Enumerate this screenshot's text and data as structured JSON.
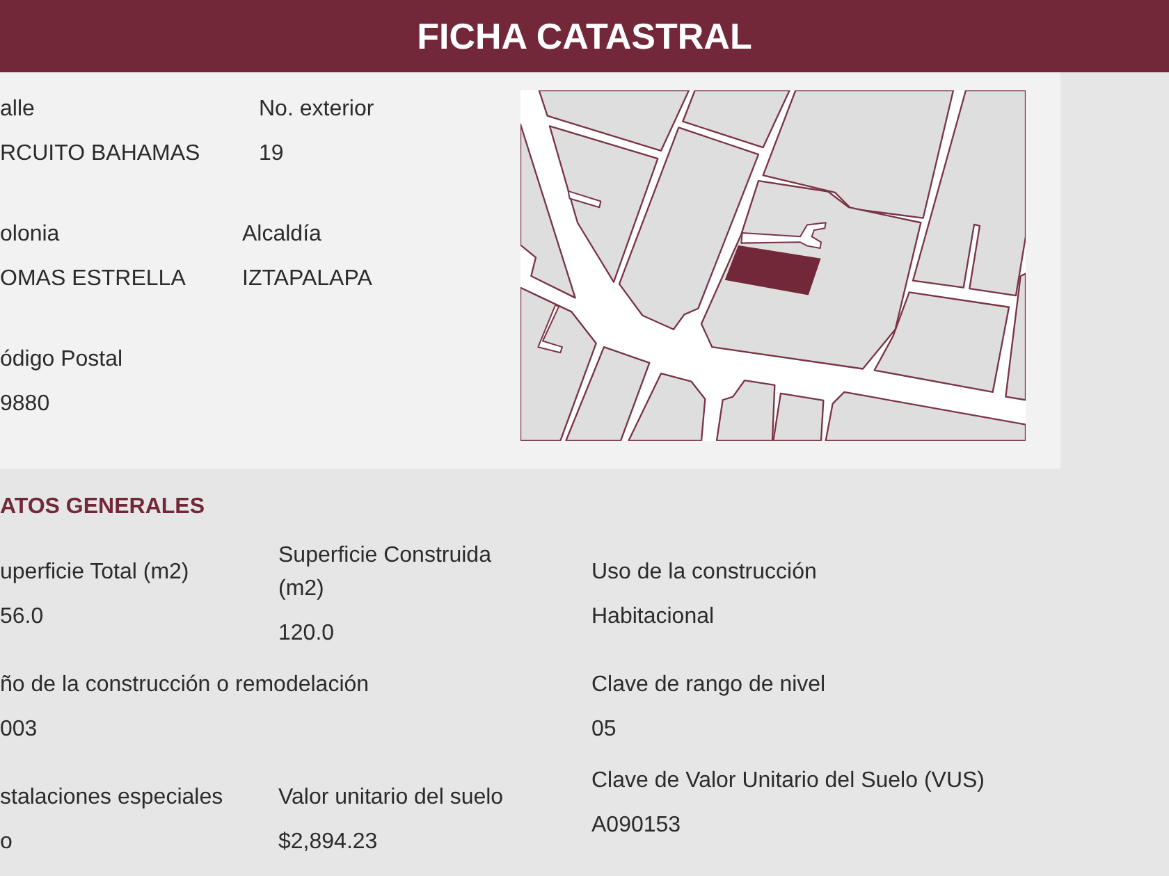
{
  "header": {
    "title": "FICHA CATASTRAL"
  },
  "address": {
    "rows": [
      [
        {
          "label": "alle",
          "value": "RCUITO BAHAMAS"
        },
        {
          "label": "No. exterior",
          "value": "19"
        }
      ],
      [
        {
          "label": "olonia",
          "value": "OMAS ESTRELLA"
        },
        {
          "label": "Alcaldía",
          "value": "IZTAPALAPA"
        }
      ],
      [
        {
          "label": "ódigo Postal",
          "value": "9880"
        }
      ]
    ]
  },
  "general": {
    "heading": "ATOS GENERALES",
    "fields": [
      {
        "label": "uperficie Total (m2)",
        "value": "56.0"
      },
      {
        "label": "Superficie Construida (m2)",
        "value": "120.0"
      },
      {
        "label": "Uso de la construcción",
        "value": "Habitacional"
      },
      {
        "label": "ño de la construcción o remodelación",
        "value": "003"
      },
      {
        "label": "Clave de rango de nivel",
        "value": "05"
      },
      {
        "label": "stalaciones especiales",
        "value": "o"
      },
      {
        "label": "Valor unitario del suelo",
        "value": "$2,894.23"
      },
      {
        "label": "Clave de Valor Unitario del Suelo (VUS)",
        "value": "A090153"
      }
    ]
  }
}
